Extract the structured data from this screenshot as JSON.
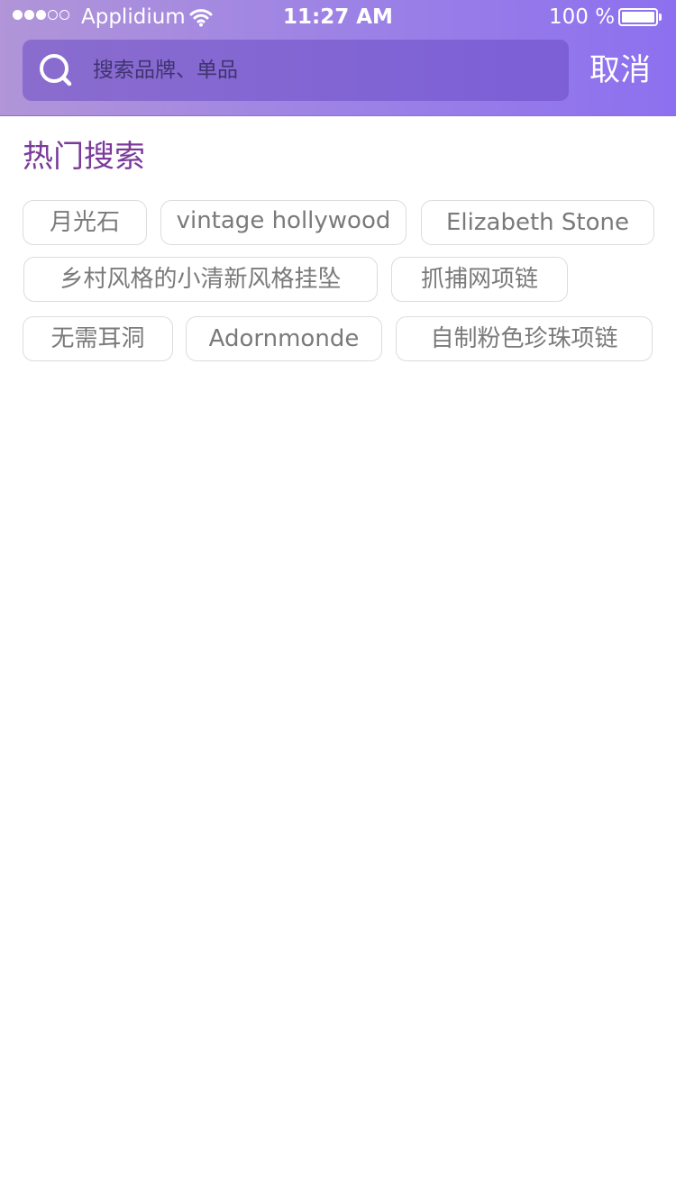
{
  "status_bar": {
    "signal_dots": [
      "filled",
      "filled",
      "filled",
      "empty",
      "empty"
    ],
    "carrier": "Applidium",
    "time": "11:27 AM",
    "battery_percent": "100 %",
    "battery_level": 1.0
  },
  "search": {
    "placeholder": "搜索品牌、单品",
    "cancel_label": "取消"
  },
  "hot_search": {
    "title": "热门搜索",
    "tags": [
      "月光石",
      "vintage hollywood",
      "Elizabeth Stone",
      "乡村风格的小清新风格挂坠",
      "抓捕网项链",
      "无需耳洞",
      "Adornmonde",
      "自制粉色珍珠项链"
    ]
  },
  "colors": {
    "header_gradient_start": "#b195d8",
    "header_gradient_end": "#8c70ef",
    "section_title": "#7b3a9a",
    "tag_text": "#7a7a7a",
    "tag_border": "#dcdcdc"
  },
  "icons": {
    "search": "search-icon",
    "wifi": "wifi-icon",
    "battery": "battery-icon"
  }
}
